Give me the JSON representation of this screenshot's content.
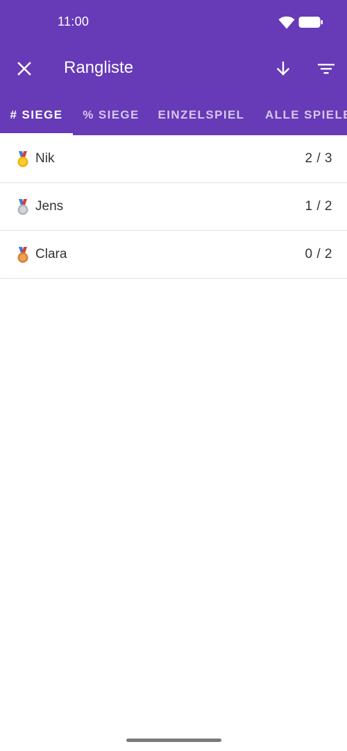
{
  "status_bar": {
    "time": "11:00"
  },
  "toolbar": {
    "title": "Rangliste",
    "close_icon": "close-icon",
    "sort_icon": "arrow-down-icon",
    "filter_icon": "filter-icon"
  },
  "tabs": [
    {
      "label": "# SIEGE",
      "selected": true
    },
    {
      "label": "% SIEGE",
      "selected": false
    },
    {
      "label": "EINZELSPIEL",
      "selected": false
    },
    {
      "label": "ALLE SPIELE",
      "selected": false
    }
  ],
  "ranking": [
    {
      "medal": "gold-medal-icon",
      "name": "Nik",
      "score": "2 / 3"
    },
    {
      "medal": "silver-medal-icon",
      "name": "Jens",
      "score": "1 / 2"
    },
    {
      "medal": "bronze-medal-icon",
      "name": "Clara",
      "score": "0 / 2"
    }
  ],
  "colors": {
    "primary": "#673ab7",
    "on_primary": "#ffffff",
    "gold": "#f4b400",
    "silver": "#b0b4bb",
    "bronze": "#d9822b"
  }
}
